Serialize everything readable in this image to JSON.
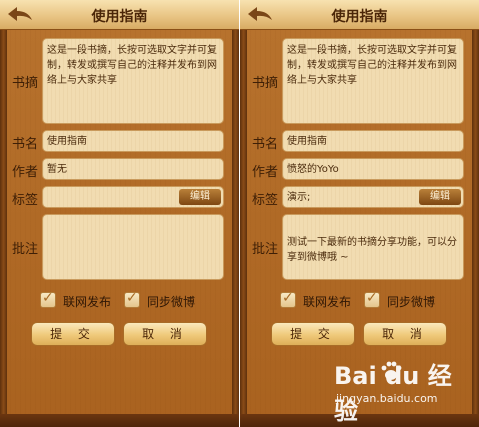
{
  "header": {
    "title": "使用指南"
  },
  "labels": {
    "excerpt": "书摘",
    "book_name": "书名",
    "author": "作者",
    "tags": "标签",
    "notes": "批注"
  },
  "edit_button": "编辑",
  "options": {
    "post_online": "联网发布",
    "sync_weibo": "同步微博"
  },
  "actions": {
    "submit": "提 交",
    "cancel": "取 消"
  },
  "left_screen": {
    "excerpt": "这是一段书摘，长按可选取文字并可复制，转发或撰写自己的注释并发布到网络上与大家共享",
    "book_name": "使用指南",
    "author": "暂无",
    "tags": "",
    "notes": ""
  },
  "right_screen": {
    "excerpt": "这是一段书摘，长按可选取文字并可复制，转发或撰写自己的注释并发布到网络上与大家共享",
    "book_name": "使用指南",
    "author": "愤怒的YoYo",
    "tags": "演示;",
    "notes": "测试一下最新的书摘分享功能，可以分享到微博哦 ~"
  },
  "watermark": {
    "brand": "Bai du 经验",
    "site": "jingyan.baidu.com"
  },
  "colors": {
    "wood": "#a9621f",
    "field": "#f1dcb1",
    "titlebar": "#e9c585"
  }
}
